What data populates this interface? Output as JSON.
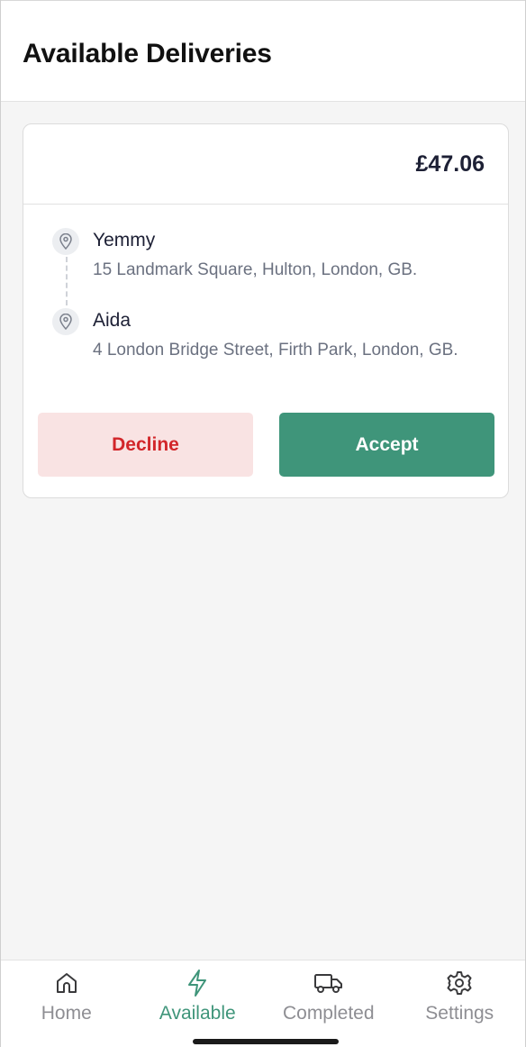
{
  "header": {
    "title": "Available Deliveries"
  },
  "delivery": {
    "price": "£47.06",
    "pickup": {
      "name": "Yemmy",
      "address": "15 Landmark Square, Hulton, London, GB."
    },
    "dropoff": {
      "name": "Aida",
      "address": "4 London Bridge Street, Firth Park, London, GB."
    },
    "decline_label": "Decline",
    "accept_label": "Accept"
  },
  "tabs": [
    {
      "label": "Home",
      "icon": "home-icon"
    },
    {
      "label": "Available",
      "icon": "lightning-icon",
      "active": true
    },
    {
      "label": "Completed",
      "icon": "truck-icon"
    },
    {
      "label": "Settings",
      "icon": "gear-icon"
    }
  ],
  "colors": {
    "accent": "#3f957a",
    "decline_bg": "#f9e3e3",
    "decline_text": "#d2262a",
    "text_dark": "#1d2035",
    "text_muted": "#6b7180"
  }
}
